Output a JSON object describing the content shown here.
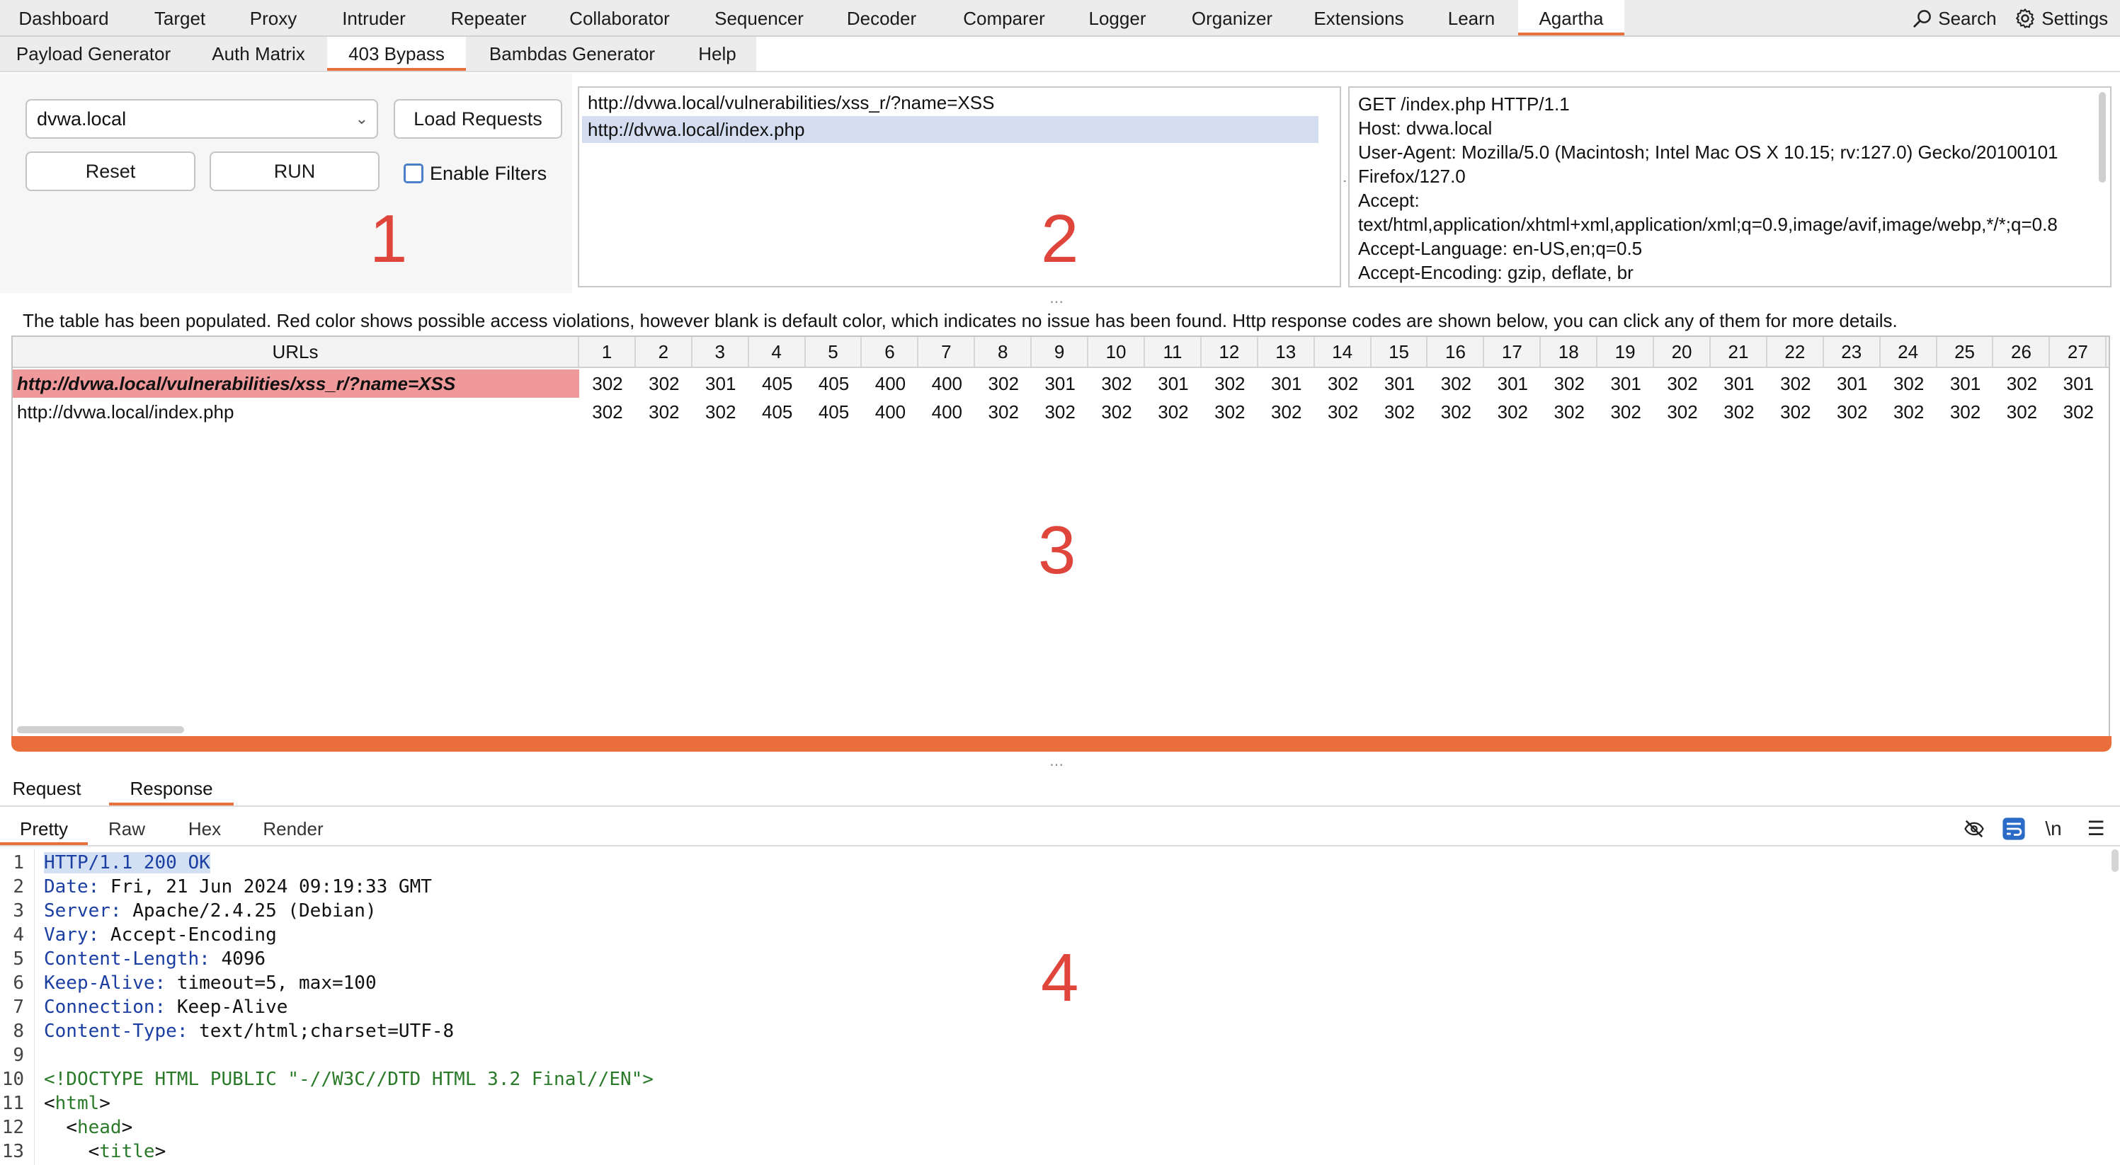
{
  "nav": {
    "tabs": [
      {
        "label": "Dashboard"
      },
      {
        "label": "Target"
      },
      {
        "label": "Proxy"
      },
      {
        "label": "Intruder"
      },
      {
        "label": "Repeater"
      },
      {
        "label": "Collaborator"
      },
      {
        "label": "Sequencer"
      },
      {
        "label": "Decoder"
      },
      {
        "label": "Comparer"
      },
      {
        "label": "Logger"
      },
      {
        "label": "Organizer"
      },
      {
        "label": "Extensions"
      },
      {
        "label": "Learn"
      },
      {
        "label": "Agartha"
      }
    ],
    "search_label": "Search",
    "settings_label": "Settings"
  },
  "subnav": {
    "tabs": [
      {
        "label": "Payload Generator"
      },
      {
        "label": "Auth Matrix"
      },
      {
        "label": "403 Bypass"
      },
      {
        "label": "Bambdas Generator"
      },
      {
        "label": "Help"
      }
    ]
  },
  "controls": {
    "host_select": "dvwa.local",
    "load_label": "Load Requests",
    "reset_label": "Reset",
    "run_label": "RUN",
    "filters_label": "Enable Filters"
  },
  "markers": {
    "one": "1",
    "two": "2",
    "three": "3",
    "four": "4"
  },
  "request_list": [
    "http://dvwa.local/vulnerabilities/xss_r/?name=XSS",
    "http://dvwa.local/index.php"
  ],
  "request_preview": [
    "GET /index.php HTTP/1.1",
    "Host: dvwa.local",
    "User-Agent: Mozilla/5.0 (Macintosh; Intel Mac OS X 10.15; rv:127.0) Gecko/20100101",
    "Firefox/127.0",
    "Accept:",
    "text/html,application/xhtml+xml,application/xml;q=0.9,image/avif,image/webp,*/*;q=0.8",
    "Accept-Language: en-US,en;q=0.5",
    "Accept-Encoding: gzip, deflate, br"
  ],
  "info_text": "The table has been populated. Red color shows possible access violations, however blank is default color, which indicates no issue has been found. Http response codes are shown below, you can click any of them for more details.",
  "table": {
    "url_header": "URLs",
    "columns": [
      "1",
      "2",
      "3",
      "4",
      "5",
      "6",
      "7",
      "8",
      "9",
      "10",
      "11",
      "12",
      "13",
      "14",
      "15",
      "16",
      "17",
      "18",
      "19",
      "20",
      "21",
      "22",
      "23",
      "24",
      "25",
      "26",
      "27"
    ],
    "rows": [
      {
        "url": "http://dvwa.local/vulnerabilities/xss_r/?name=XSS",
        "violation": true,
        "codes": [
          "302",
          "302",
          "301",
          "405",
          "405",
          "400",
          "400",
          "302",
          "301",
          "302",
          "301",
          "302",
          "301",
          "302",
          "301",
          "302",
          "301",
          "302",
          "301",
          "302",
          "301",
          "302",
          "301",
          "302",
          "301",
          "302",
          "301"
        ]
      },
      {
        "url": "http://dvwa.local/index.php",
        "violation": false,
        "codes": [
          "302",
          "302",
          "302",
          "405",
          "405",
          "400",
          "400",
          "302",
          "302",
          "302",
          "302",
          "302",
          "302",
          "302",
          "302",
          "302",
          "302",
          "302",
          "302",
          "302",
          "302",
          "302",
          "302",
          "302",
          "302",
          "302",
          "302"
        ]
      }
    ]
  },
  "bottom": {
    "tabs": [
      {
        "label": "Request"
      },
      {
        "label": "Response"
      }
    ],
    "view_tabs": [
      {
        "label": "Pretty"
      },
      {
        "label": "Raw"
      },
      {
        "label": "Hex"
      },
      {
        "label": "Render"
      }
    ],
    "newline_toggle": "\\n"
  },
  "response_lines": [
    {
      "n": "1",
      "key": "HTTP/1.1 200 OK",
      "val": ""
    },
    {
      "n": "2",
      "key": "Date:",
      "val": " Fri, 21 Jun 2024 09:19:33 GMT"
    },
    {
      "n": "3",
      "key": "Server:",
      "val": " Apache/2.4.25 (Debian)"
    },
    {
      "n": "4",
      "key": "Vary:",
      "val": " Accept-Encoding"
    },
    {
      "n": "5",
      "key": "Content-Length:",
      "val": " 4096"
    },
    {
      "n": "6",
      "key": "Keep-Alive:",
      "val": " timeout=5, max=100"
    },
    {
      "n": "7",
      "key": "Connection:",
      "val": " Keep-Alive"
    },
    {
      "n": "8",
      "key": "Content-Type:",
      "val": " text/html;charset=UTF-8"
    },
    {
      "n": "9",
      "key": "",
      "val": ""
    },
    {
      "n": "10",
      "key": "",
      "doctype": "<!DOCTYPE HTML PUBLIC \"-//W3C//DTD HTML 3.2 Final//EN\">"
    },
    {
      "n": "11",
      "key": "",
      "tag_open": "<",
      "tag": "html",
      "tag_close": ">",
      "indent": ""
    },
    {
      "n": "12",
      "key": "",
      "tag_open": "<",
      "tag": "head",
      "tag_close": ">",
      "indent": "  "
    },
    {
      "n": "13",
      "key": "",
      "tag_open": "<",
      "tag": "title",
      "tag_close": ">",
      "indent": "    "
    }
  ]
}
